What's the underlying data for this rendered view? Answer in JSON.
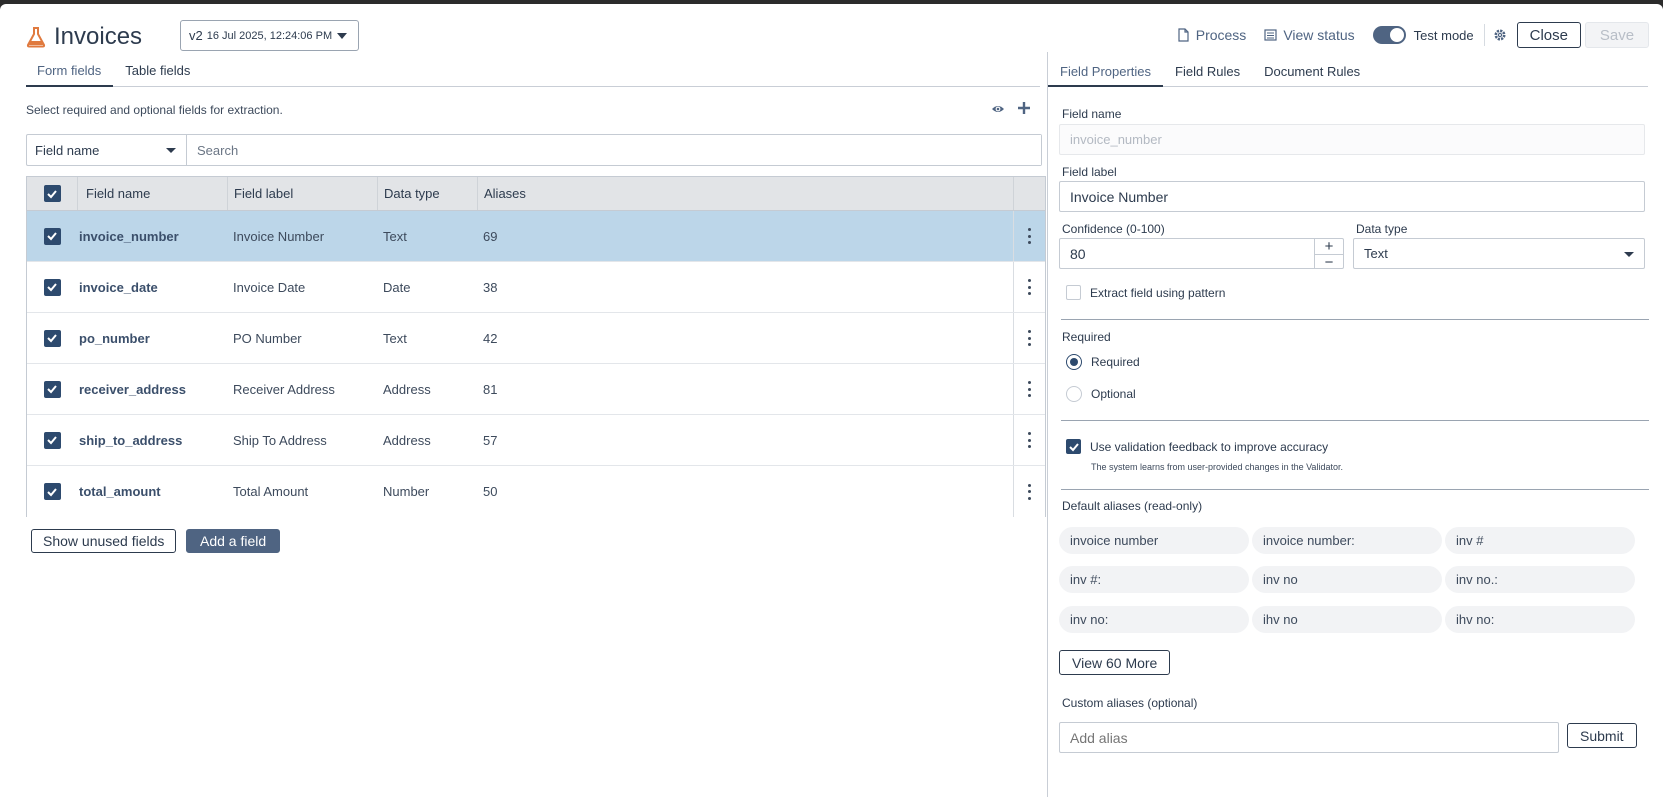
{
  "app": {
    "title": "Invoices",
    "version": "v2",
    "timestamp": "16 Jul 2025, 12:24:06 PM"
  },
  "header": {
    "process_label": "Process",
    "view_status_label": "View status",
    "test_mode_label": "Test mode",
    "test_mode_on": true,
    "close_label": "Close",
    "save_label": "Save"
  },
  "left": {
    "tabs": [
      "Form fields",
      "Table fields"
    ],
    "hint": "Select required and optional fields for extraction.",
    "search_filter": "Field name",
    "search_placeholder": "Search",
    "columns": [
      "Field name",
      "Field label",
      "Data type",
      "Aliases"
    ],
    "rows": [
      {
        "name": "invoice_number",
        "label": "Invoice Number",
        "type": "Text",
        "aliases": "69"
      },
      {
        "name": "invoice_date",
        "label": "Invoice Date",
        "type": "Date",
        "aliases": "38"
      },
      {
        "name": "po_number",
        "label": "PO Number",
        "type": "Text",
        "aliases": "42"
      },
      {
        "name": "receiver_address",
        "label": "Receiver Address",
        "type": "Address",
        "aliases": "81"
      },
      {
        "name": "ship_to_address",
        "label": "Ship To Address",
        "type": "Address",
        "aliases": "57"
      },
      {
        "name": "total_amount",
        "label": "Total Amount",
        "type": "Number",
        "aliases": "50"
      }
    ],
    "show_unused_label": "Show unused fields",
    "add_field_label": "Add a field"
  },
  "right": {
    "tabs": [
      "Field Properties",
      "Field Rules",
      "Document Rules"
    ],
    "field_name_label": "Field name",
    "field_name_value": "invoice_number",
    "field_label_label": "Field label",
    "field_label_value": "Invoice Number",
    "confidence_label": "Confidence (0-100)",
    "confidence_value": "80",
    "data_type_label": "Data type",
    "data_type_value": "Text",
    "pattern_label": "Extract field using pattern",
    "required_heading": "Required",
    "required_option": "Required",
    "optional_option": "Optional",
    "feedback_label": "Use validation feedback to improve accuracy",
    "feedback_hint": "The system learns from user-provided changes in the Validator.",
    "default_aliases_label": "Default aliases (read-only)",
    "aliases": [
      "invoice number",
      "invoice number:",
      "inv #",
      "inv #:",
      "inv no",
      "inv no.:",
      "inv no:",
      "ihv no",
      "ihv no:"
    ],
    "view_more_label": "View 60 More",
    "custom_aliases_label": "Custom aliases (optional)",
    "add_alias_placeholder": "Add alias",
    "submit_label": "Submit"
  },
  "colors": {
    "accent": "#2d4a6e",
    "selected_row": "#bcd6e9",
    "flask": "#e07a3f"
  }
}
